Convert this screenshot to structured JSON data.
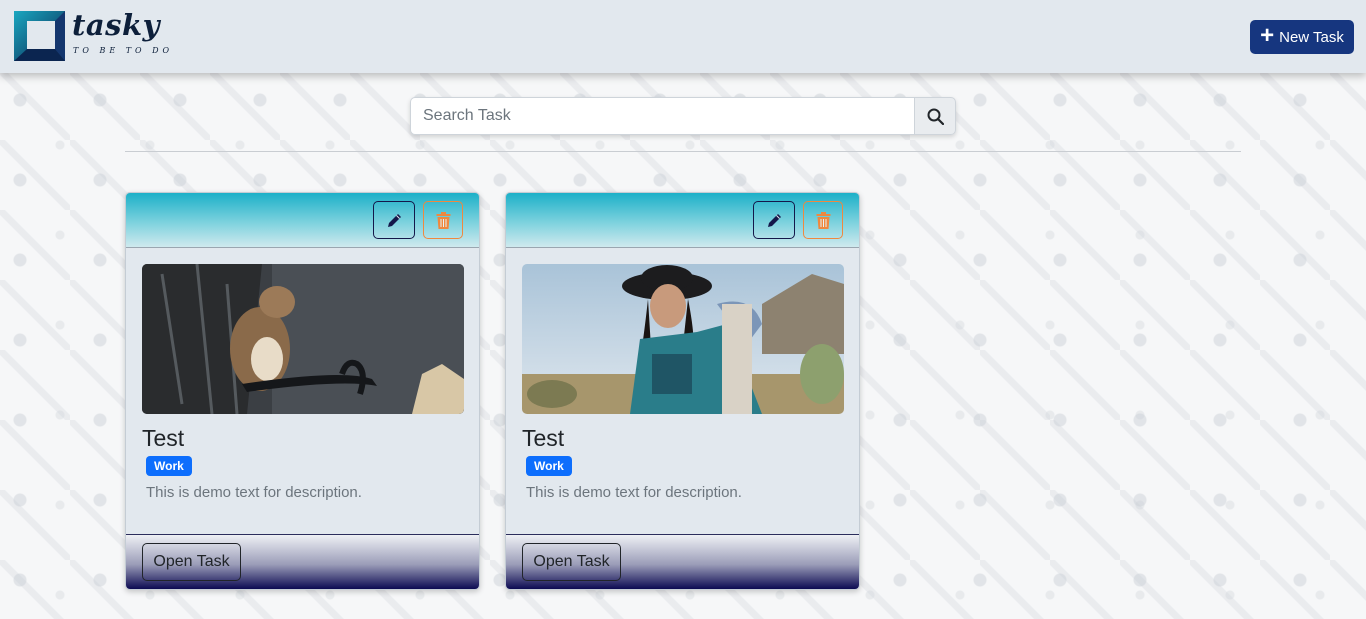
{
  "brand": {
    "name": "tasky",
    "tagline": "TO BE TO DO"
  },
  "header": {
    "new_task_label": "New Task"
  },
  "search": {
    "placeholder": "Search Task"
  },
  "colors": {
    "primary": "#16367f",
    "badge": "#0d6efd",
    "delete": "#f0883e"
  },
  "cards": [
    {
      "title": "Test",
      "tag": "Work",
      "description": "This is demo text for description.",
      "open_label": "Open Task",
      "image": "squirrel-photo"
    },
    {
      "title": "Test",
      "tag": "Work",
      "description": "This is demo text for description.",
      "open_label": "Open Task",
      "image": "woman-in-hat-photo"
    }
  ]
}
